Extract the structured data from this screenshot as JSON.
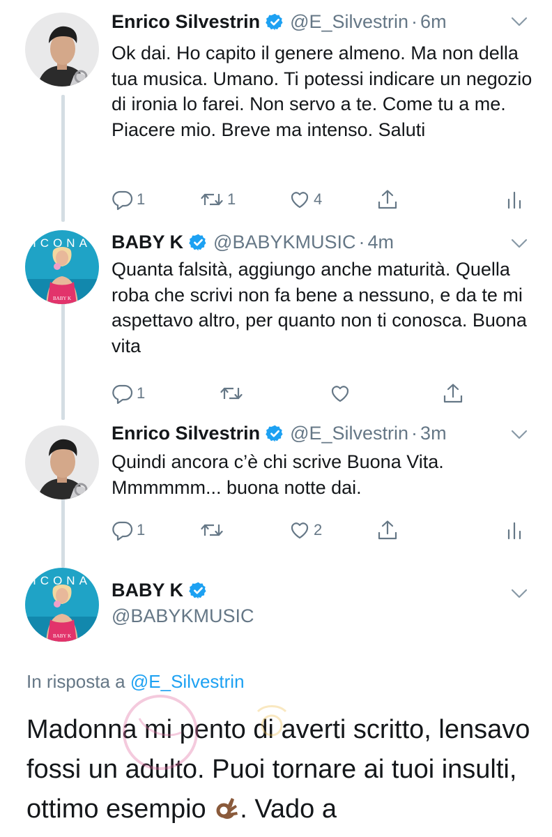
{
  "tweets": [
    {
      "name": "Enrico Silvestrin",
      "handle": "@E_Silvestrin",
      "separator": "·",
      "time": "6m",
      "text": "Ok dai. Ho capito il genere almeno. Ma non della tua musica. Umano. Ti potessi indicare un negozio di ironia lo farei. Non servo a te. Come tu a me. Piacere mio. Breve ma intenso. Saluti",
      "replies": "1",
      "retweets": "1",
      "likes": "4"
    },
    {
      "name": "BABY K",
      "handle": "@BABYKMUSIC",
      "separator": "·",
      "time": "4m",
      "text": "Quanta falsità, aggiungo anche maturità. Quella roba che scrivi non fa bene a nessuno, e da te mi aspettavo altro, per quanto non ti conosca. Buona vita",
      "replies": "1",
      "retweets": "",
      "likes": ""
    },
    {
      "name": "Enrico Silvestrin",
      "handle": "@E_Silvestrin",
      "separator": "·",
      "time": "3m",
      "text": "Quindi ancora c’è chi scrive Buona Vita. Mmmmmm... buona notte dai.",
      "replies": "1",
      "retweets": "",
      "likes": "2"
    }
  ],
  "detail": {
    "name": "BABY K",
    "handle": "@BABYKMUSIC",
    "reply_prefix": "In risposta a",
    "reply_mention": "@E_Silvestrin",
    "text_part1": "Madonna mi pento di averti scritto, lensavo fossi un adulto. Puoi tornare ai tuoi insulti, ottimo esempio",
    "text_part2": ". Vado a",
    "emoji": "ok-hand-emoji"
  },
  "avatar_text": {
    "baby_k_album": "ICONA",
    "baby_k_small": "BABY K"
  },
  "icons": [
    "verified-badge-icon",
    "chevron-down-icon",
    "reply-icon",
    "retweet-icon",
    "like-icon",
    "share-icon",
    "analytics-icon"
  ],
  "colors": {
    "text": "#14171a",
    "secondary": "#657786",
    "verified": "#1da1f2",
    "link": "#1da1f2",
    "thread_line": "#d4dde3"
  }
}
